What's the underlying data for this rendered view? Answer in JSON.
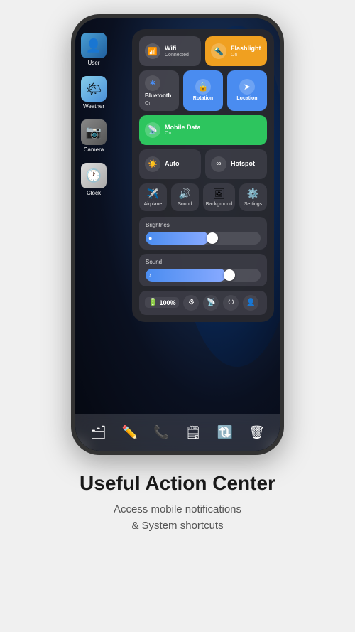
{
  "phone": {
    "apps": [
      {
        "id": "user",
        "icon": "👤",
        "label": "User",
        "class": "icon-user"
      },
      {
        "id": "weather",
        "icon": "🌤",
        "label": "Weather",
        "class": "icon-weather"
      },
      {
        "id": "camera",
        "icon": "📷",
        "label": "Camera",
        "class": "icon-camera"
      },
      {
        "id": "clock",
        "icon": "🕐",
        "label": "Clock",
        "class": "icon-clock"
      }
    ],
    "control_center": {
      "buttons": [
        {
          "id": "wifi",
          "label": "Wifi",
          "sub": "Connected",
          "icon": "📶",
          "class": "btn-wifi"
        },
        {
          "id": "flashlight",
          "label": "Flashlight",
          "sub": "On",
          "icon": "🔦",
          "class": "btn-flashlight"
        },
        {
          "id": "bluetooth",
          "label": "Bluetooth",
          "sub": "On",
          "icon": "🔷",
          "class": "btn-bluetooth"
        },
        {
          "id": "rotation",
          "label": "Rotation",
          "sub": "",
          "icon": "🔄",
          "class": "btn-rotation"
        },
        {
          "id": "location",
          "label": "Location",
          "sub": "",
          "icon": "📍",
          "class": "btn-location"
        },
        {
          "id": "mobile",
          "label": "Mobile Data",
          "sub": "On",
          "icon": "📡",
          "class": "btn-mobile"
        }
      ],
      "row2": [
        {
          "id": "auto",
          "label": "Auto",
          "icon": "☀️",
          "class": "btn-auto"
        },
        {
          "id": "hotspot",
          "label": "Hotspot",
          "icon": "🔗",
          "class": "btn-hotspot"
        }
      ],
      "row3": [
        {
          "id": "airplane",
          "label": "Airplane",
          "icon": "✈️"
        },
        {
          "id": "sound",
          "label": "Sound",
          "icon": "🔊"
        },
        {
          "id": "background",
          "label": "Background",
          "icon": "🖼️"
        },
        {
          "id": "settings",
          "label": "Settings",
          "icon": "⚙️"
        }
      ],
      "brightness": {
        "label": "Brightnes",
        "fill_width": "55%",
        "thumb_left": "53%"
      },
      "sound": {
        "label": "Sound",
        "fill_width": "70%",
        "thumb_left": "68%"
      },
      "status": {
        "battery_icon": "🔋",
        "battery_pct": "100%",
        "settings_icon": "⚙️",
        "mobile_icon": "📡",
        "power_icon": "⏻",
        "user_icon": "👤"
      }
    },
    "dock": [
      "🗂️",
      "✏️",
      "📞",
      "🗒️",
      "🔃",
      "🗑️"
    ]
  },
  "page": {
    "title": "Useful Action Center",
    "subtitle": "Access mobile notifications\n& System shortcuts"
  }
}
